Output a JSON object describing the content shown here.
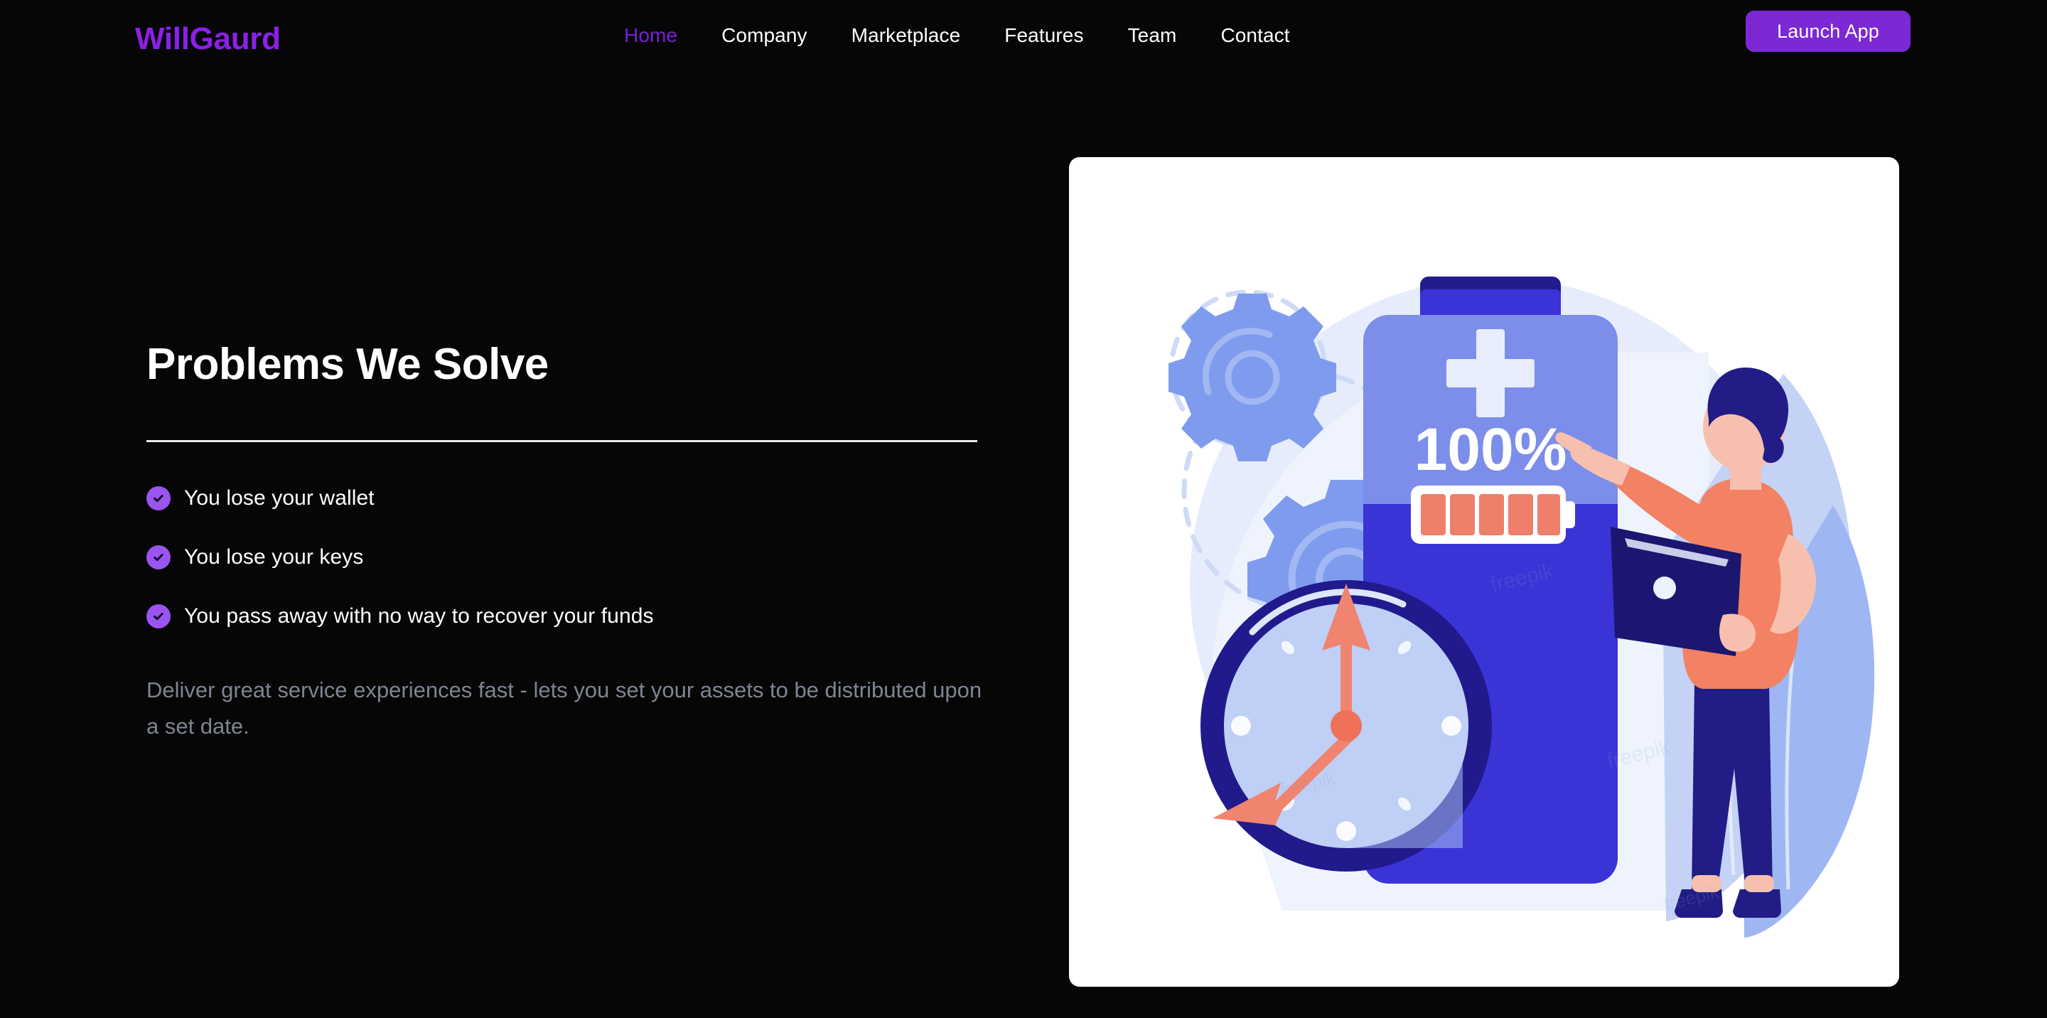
{
  "brand": {
    "name": "WillGaurd",
    "color": "#8B20E8"
  },
  "nav": {
    "items": [
      {
        "label": "Home",
        "active": true
      },
      {
        "label": "Company",
        "active": false
      },
      {
        "label": "Marketplace",
        "active": false
      },
      {
        "label": "Features",
        "active": false
      },
      {
        "label": "Team",
        "active": false
      },
      {
        "label": "Contact",
        "active": false
      }
    ],
    "cta": {
      "label": "Launch App",
      "bg": "#7C28D4",
      "text_color": "#FFFFFF"
    }
  },
  "main": {
    "title": "Problems We Solve",
    "bullets": [
      "You lose your wallet",
      "You lose your keys",
      "You pass away with no way to recover your funds"
    ],
    "lead": "Deliver great service experiences fast - lets you set your assets to be distributed upon a set date.",
    "bullet_icon": "check-circle-icon",
    "bullet_icon_color": "#9A54F0"
  },
  "illustration": {
    "alt": "battery-charging-illustration",
    "battery_percent_label": "100%",
    "plus_symbol": "+",
    "battery_bars": 5,
    "watermark": "freepik",
    "colors": {
      "card_bg": "#FFFFFF",
      "battery_light": "#7C8EEA",
      "battery_dark": "#3A33D6",
      "battery_cap": "#231C8E",
      "gear": "#7E9BEE",
      "clock_rim": "#201A8C",
      "clock_face": "#BFCFF6",
      "hand": "#F0846F",
      "bars": "#EE7F6B",
      "skin": "#F7C0AE",
      "shirt": "#F28263",
      "hair_pants": "#221C86",
      "leaf_light": "#C3D1F5",
      "leaf_mid": "#9DB6F2",
      "bg_blob": "#E4EAFB"
    }
  }
}
